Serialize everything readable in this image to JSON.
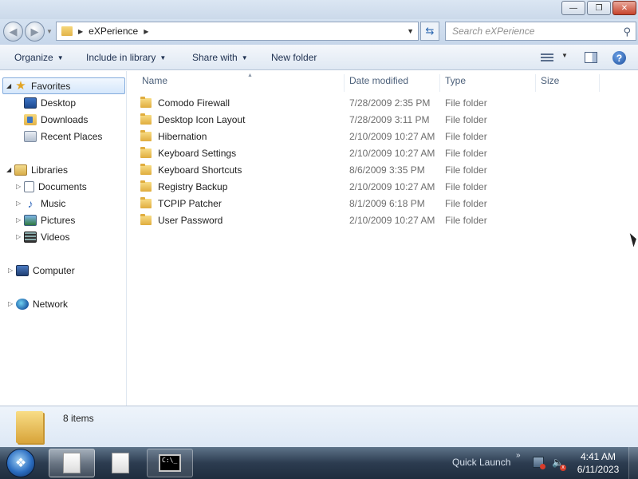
{
  "window": {
    "minimize_glyph": "—",
    "maximize_glyph": "❐",
    "close_glyph": "✕"
  },
  "address": {
    "path": "eXPerience",
    "search_placeholder": "Search eXPerience"
  },
  "toolbar": {
    "organize": "Organize",
    "include_in_library": "Include in library",
    "share_with": "Share with",
    "new_folder": "New folder",
    "help_glyph": "?"
  },
  "navigation": {
    "favorites": "Favorites",
    "desktop": "Desktop",
    "downloads": "Downloads",
    "recent_places": "Recent Places",
    "libraries": "Libraries",
    "documents": "Documents",
    "music": "Music",
    "pictures": "Pictures",
    "videos": "Videos",
    "computer": "Computer",
    "network": "Network"
  },
  "columns": {
    "name": "Name",
    "date_modified": "Date modified",
    "type": "Type",
    "size": "Size"
  },
  "files": [
    {
      "name": "Comodo Firewall",
      "date": "7/28/2009 2:35 PM",
      "type": "File folder"
    },
    {
      "name": "Desktop Icon Layout",
      "date": "7/28/2009 3:11 PM",
      "type": "File folder"
    },
    {
      "name": "Hibernation",
      "date": "2/10/2009 10:27 AM",
      "type": "File folder"
    },
    {
      "name": "Keyboard Settings",
      "date": "2/10/2009 10:27 AM",
      "type": "File folder"
    },
    {
      "name": "Keyboard Shortcuts",
      "date": "8/6/2009 3:35 PM",
      "type": "File folder"
    },
    {
      "name": "Registry Backup",
      "date": "2/10/2009 10:27 AM",
      "type": "File folder"
    },
    {
      "name": "TCPIP Patcher",
      "date": "8/1/2009 6:18 PM",
      "type": "File folder"
    },
    {
      "name": "User Password",
      "date": "2/10/2009 10:27 AM",
      "type": "File folder"
    }
  ],
  "details": {
    "item_count": "8 items"
  },
  "taskbar": {
    "quick_launch": "Quick Launch",
    "time": "4:41 AM",
    "date": "6/11/2023",
    "cmd_text": "C:\\_"
  }
}
